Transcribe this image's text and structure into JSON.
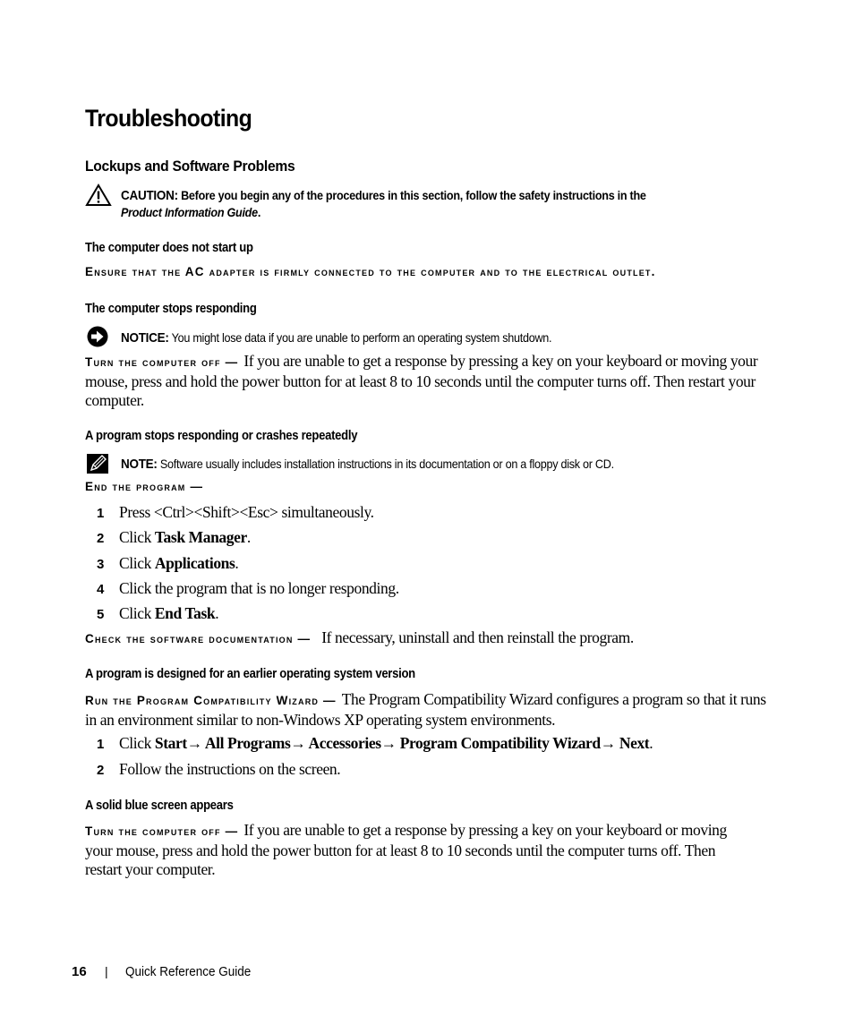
{
  "page_title": "Troubleshooting",
  "section_title": "Lockups and Software Problems",
  "caution": {
    "icon": "warning-triangle-icon",
    "label": "CAUTION:",
    "text_line1": "Before you begin any of the procedures in this section, follow the safety instructions in the",
    "text_line2": "Product Information Guide",
    "text_line2_end": "."
  },
  "subsections": [
    {
      "title": "The computer does not start up",
      "instruction": "Ensure that the AC adapter is firmly connected to the computer and to the electrical outlet."
    },
    {
      "title": "The computer stops responding",
      "notice": {
        "icon": "notice-arrow-icon",
        "label": "NOTICE:",
        "text": "You might lose data if you are unable to perform an operating system shutdown."
      },
      "lead": "Turn the computer off —",
      "body": "If you are unable to get a response by pressing a key on your keyboard or moving your mouse, press and hold the power button for at least 8 to 10 seconds until the computer turns off. Then restart your computer."
    },
    {
      "title": "A program stops responding or crashes repeatedly",
      "note": {
        "icon": "pencil-note-icon",
        "label": "NOTE:",
        "text": "Software usually includes installation instructions in its documentation or on a floppy disk or CD."
      },
      "lead": "End the program —",
      "steps": [
        {
          "num": "1",
          "pre": "Press <Ctrl><Shift><Esc> simultaneously.",
          "bold": "",
          "post": ""
        },
        {
          "num": "2",
          "pre": "Click ",
          "bold": "Task Manager",
          "post": "."
        },
        {
          "num": "3",
          "pre": "Click ",
          "bold": "Applications",
          "post": "."
        },
        {
          "num": "4",
          "pre": "Click the program that is no longer responding.",
          "bold": "",
          "post": ""
        },
        {
          "num": "5",
          "pre": "Click ",
          "bold": "End Task",
          "post": "."
        }
      ],
      "lead2": "Check the software documentation —",
      "body2": "If necessary, uninstall and then reinstall the program."
    },
    {
      "title": "A program is designed for an earlier operating system version",
      "lead": "Run the Program Compatibility Wizard —",
      "body": "The Program Compatibility Wizard configures a program so that it runs in an environment similar to non-Windows XP operating system environments.",
      "steps": [
        {
          "num": "1",
          "pre": "Click ",
          "bold": "Start→ All Programs→ Accessories→ Program Compatibility Wizard→ Next",
          "post": "."
        },
        {
          "num": "2",
          "pre": "Follow the instructions on the screen.",
          "bold": "",
          "post": ""
        }
      ]
    },
    {
      "title": "A solid blue screen appears",
      "lead": "Turn the computer off —",
      "body": "If you are unable to get a response by pressing a key on your keyboard or moving your mouse, press and hold the power button for at least 8 to 10 seconds until the computer turns off. Then restart your computer."
    }
  ],
  "footer": {
    "page_number": "16",
    "separator": "|",
    "guide_title": "Quick Reference Guide"
  }
}
